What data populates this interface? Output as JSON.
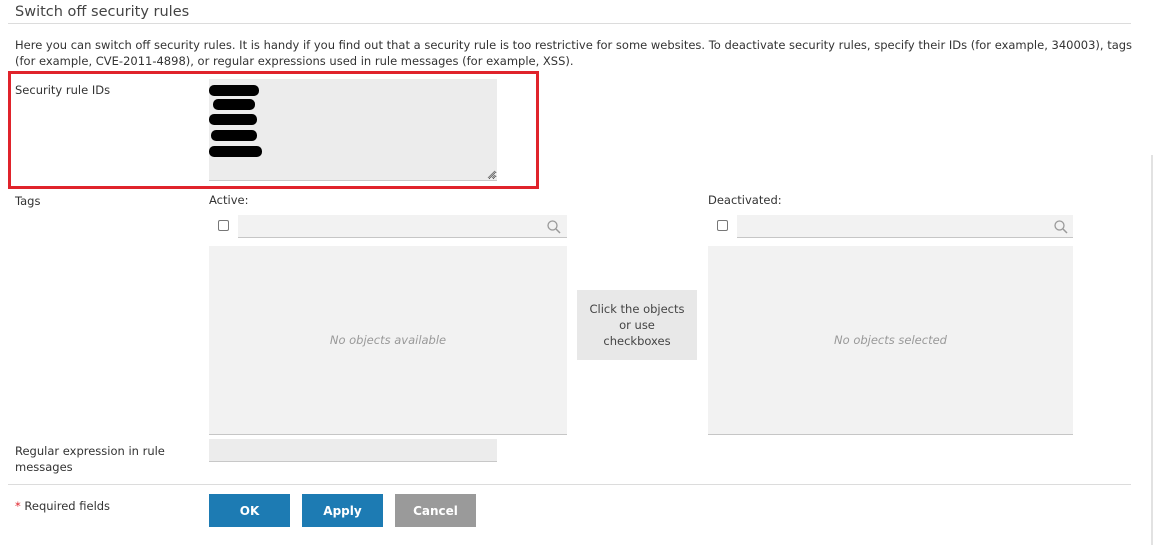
{
  "section": {
    "title": "Switch off security rules",
    "description": "Here you can switch off security rules. It is handy if you find out that a security rule is too restrictive for some websites. To deactivate security rules, specify their IDs (for example, 340003), tags (for example, CVE-2011-4898), or regular expressions used in rule messages (for example, XSS)."
  },
  "fields": {
    "security_rule_ids_label": "Security rule IDs",
    "tags_label": "Tags",
    "regex_label": "Regular expression in rule messages"
  },
  "tags": {
    "active_label": "Active:",
    "deactivated_label": "Deactivated:",
    "active_empty": "No objects available",
    "deactivated_empty": "No objects selected",
    "move_hint": "Click the objects or use checkboxes"
  },
  "footer": {
    "required_star": "*",
    "required_text": " Required fields",
    "ok_label": "OK",
    "apply_label": "Apply",
    "cancel_label": "Cancel"
  },
  "colors": {
    "accent": "#1d7bb3",
    "highlight": "#e0232b",
    "cancel": "#9a9a9a"
  }
}
